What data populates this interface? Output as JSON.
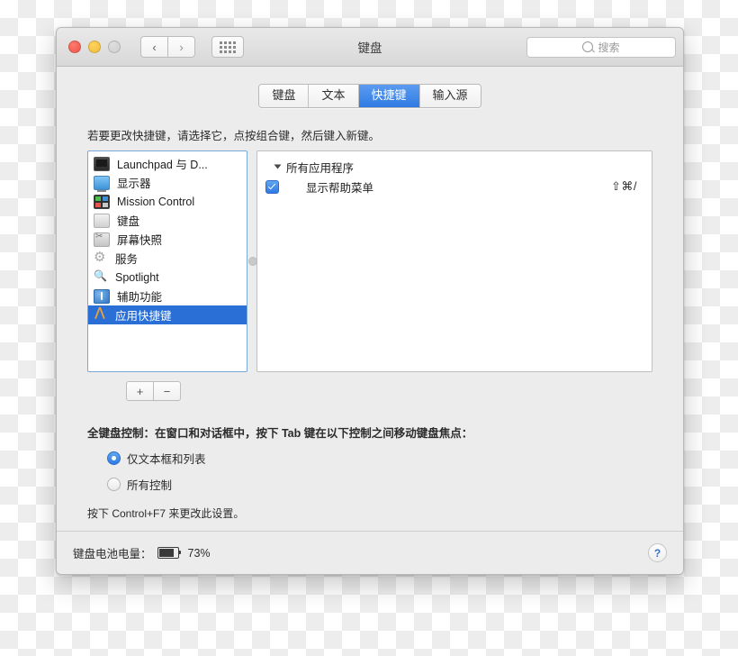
{
  "window": {
    "title": "键盘",
    "traffic": {
      "close": "close-button",
      "minimize": "minimize-button",
      "zoom": "zoom-button"
    },
    "nav": {
      "back": "‹",
      "forward": "›"
    },
    "grid_button": "show-all-preferences"
  },
  "search": {
    "placeholder": "搜索",
    "value": ""
  },
  "tabs": [
    {
      "label": "键盘",
      "active": false
    },
    {
      "label": "文本",
      "active": false
    },
    {
      "label": "快捷键",
      "active": true
    },
    {
      "label": "输入源",
      "active": false
    }
  ],
  "hint": "若要更改快捷键，请选择它，点按组合键，然后键入新键。",
  "sidebar": {
    "items": [
      {
        "label": "Launchpad 与 D...",
        "icon": "launchpad-icon",
        "selected": false
      },
      {
        "label": "显示器",
        "icon": "display-icon",
        "selected": false
      },
      {
        "label": "Mission Control",
        "icon": "mission-control-icon",
        "selected": false
      },
      {
        "label": "键盘",
        "icon": "keyboard-icon",
        "selected": false
      },
      {
        "label": "屏幕快照",
        "icon": "screenshot-icon",
        "selected": false
      },
      {
        "label": "服务",
        "icon": "services-gear-icon",
        "selected": false
      },
      {
        "label": "Spotlight",
        "icon": "spotlight-icon",
        "selected": false
      },
      {
        "label": "辅助功能",
        "icon": "accessibility-icon",
        "selected": false
      },
      {
        "label": "应用快捷键",
        "icon": "app-shortcut-icon",
        "selected": true
      }
    ]
  },
  "detail": {
    "group_label": "所有应用程序",
    "rows": [
      {
        "label": "显示帮助菜单",
        "shortcut": "⇧⌘/",
        "checked": true
      }
    ]
  },
  "plusminus": {
    "add": "+",
    "remove": "−"
  },
  "full_keyboard_access": {
    "title": "全键盘控制：在窗口和对话框中，按下 Tab 键在以下控制之间移动键盘焦点：",
    "options": [
      {
        "label": "仅文本框和列表",
        "selected": true
      },
      {
        "label": "所有控制",
        "selected": false
      }
    ],
    "note": "按下 Control+F7 来更改此设置。"
  },
  "footer": {
    "battery_label": "键盘电池电量：",
    "battery_percent": "73%",
    "help": "?"
  }
}
